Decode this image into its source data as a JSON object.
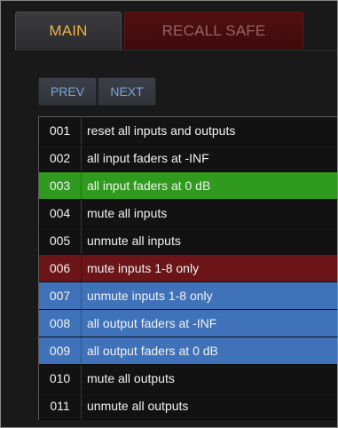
{
  "tabs": [
    {
      "label": "MAIN",
      "active": true
    },
    {
      "label": "RECALL SAFE",
      "active": false
    }
  ],
  "nav": {
    "prev_label": "PREV",
    "next_label": "NEXT"
  },
  "rows": [
    {
      "num": "001",
      "label": "reset all inputs and outputs",
      "state": "normal"
    },
    {
      "num": "002",
      "label": "all input faders at -INF",
      "state": "normal"
    },
    {
      "num": "003",
      "label": "all input faders at 0 dB",
      "state": "green"
    },
    {
      "num": "004",
      "label": "mute all inputs",
      "state": "normal"
    },
    {
      "num": "005",
      "label": "unmute all inputs",
      "state": "normal"
    },
    {
      "num": "006",
      "label": "mute inputs 1-8 only",
      "state": "red"
    },
    {
      "num": "007",
      "label": "unmute inputs 1-8 only",
      "state": "blue"
    },
    {
      "num": "008",
      "label": "all output faders at -INF",
      "state": "blue"
    },
    {
      "num": "009",
      "label": "all output faders at 0 dB",
      "state": "blue"
    },
    {
      "num": "010",
      "label": "mute all outputs",
      "state": "normal"
    },
    {
      "num": "011",
      "label": "unmute all outputs",
      "state": "normal"
    }
  ],
  "colors": {
    "active_tab_text": "#f0b04a",
    "recall_tab_bg": "#520f12",
    "current_row": "#2f9a1d",
    "recall_safe_row": "#6b1518",
    "selected_row": "#3f72b8"
  }
}
